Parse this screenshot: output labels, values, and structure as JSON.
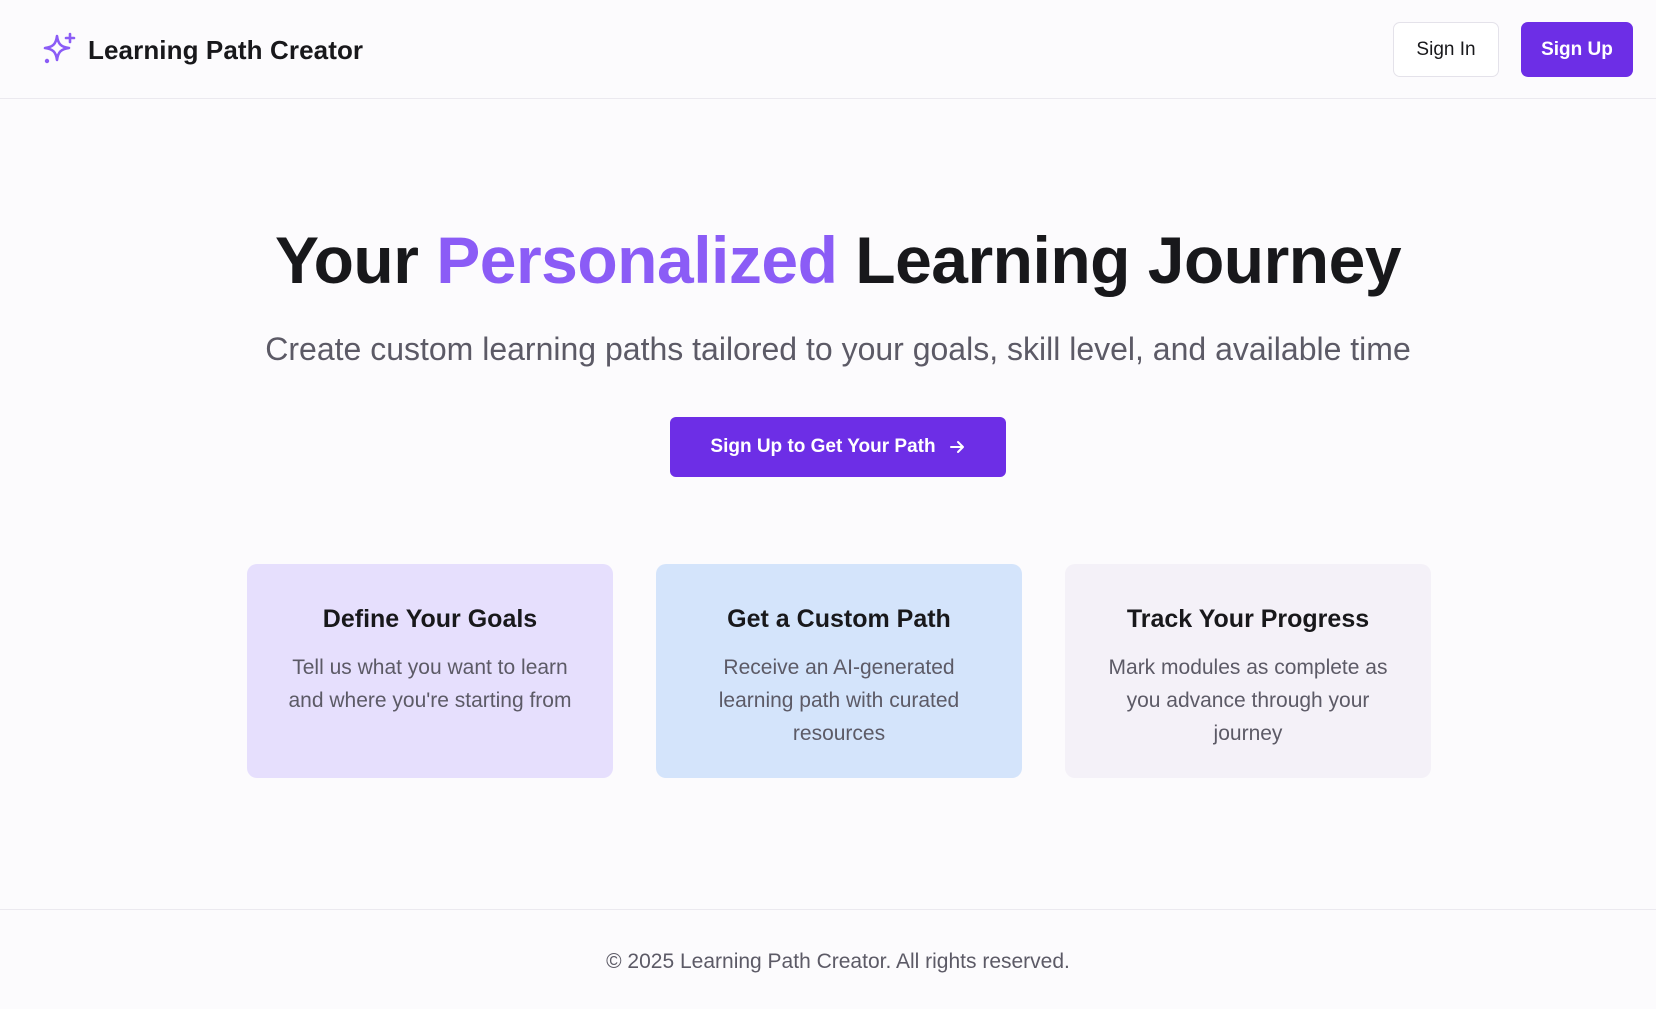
{
  "header": {
    "brand_title": "Learning Path Creator",
    "brand_icon": "sparkles-icon",
    "sign_in_label": "Sign In",
    "sign_up_label": "Sign Up"
  },
  "hero": {
    "title_prefix": "Your",
    "title_accent": "Personalized",
    "title_suffix": "Learning Journey",
    "subtitle": "Create custom learning paths tailored to your goals, skill level, and available time",
    "cta_label": "Sign Up to Get Your Path",
    "cta_icon": "arrow-right-icon"
  },
  "features": [
    {
      "title": "Define Your Goals",
      "description": "Tell us what you want to learn and where you're starting from"
    },
    {
      "title": "Get a Custom Path",
      "description": "Receive an AI-generated learning path with curated resources"
    },
    {
      "title": "Track Your Progress",
      "description": "Mark modules as complete as you advance through your journey"
    }
  ],
  "footer": {
    "text": "© 2025 Learning Path Creator. All rights reserved."
  },
  "colors": {
    "primary": "#6d2ee6",
    "accent": "#8b5cf6",
    "card_goals_bg": "#e6dffd",
    "card_path_bg": "#d4e4fb",
    "card_progress_bg": "#f4f1f8",
    "page_bg": "#fcfbfd"
  }
}
